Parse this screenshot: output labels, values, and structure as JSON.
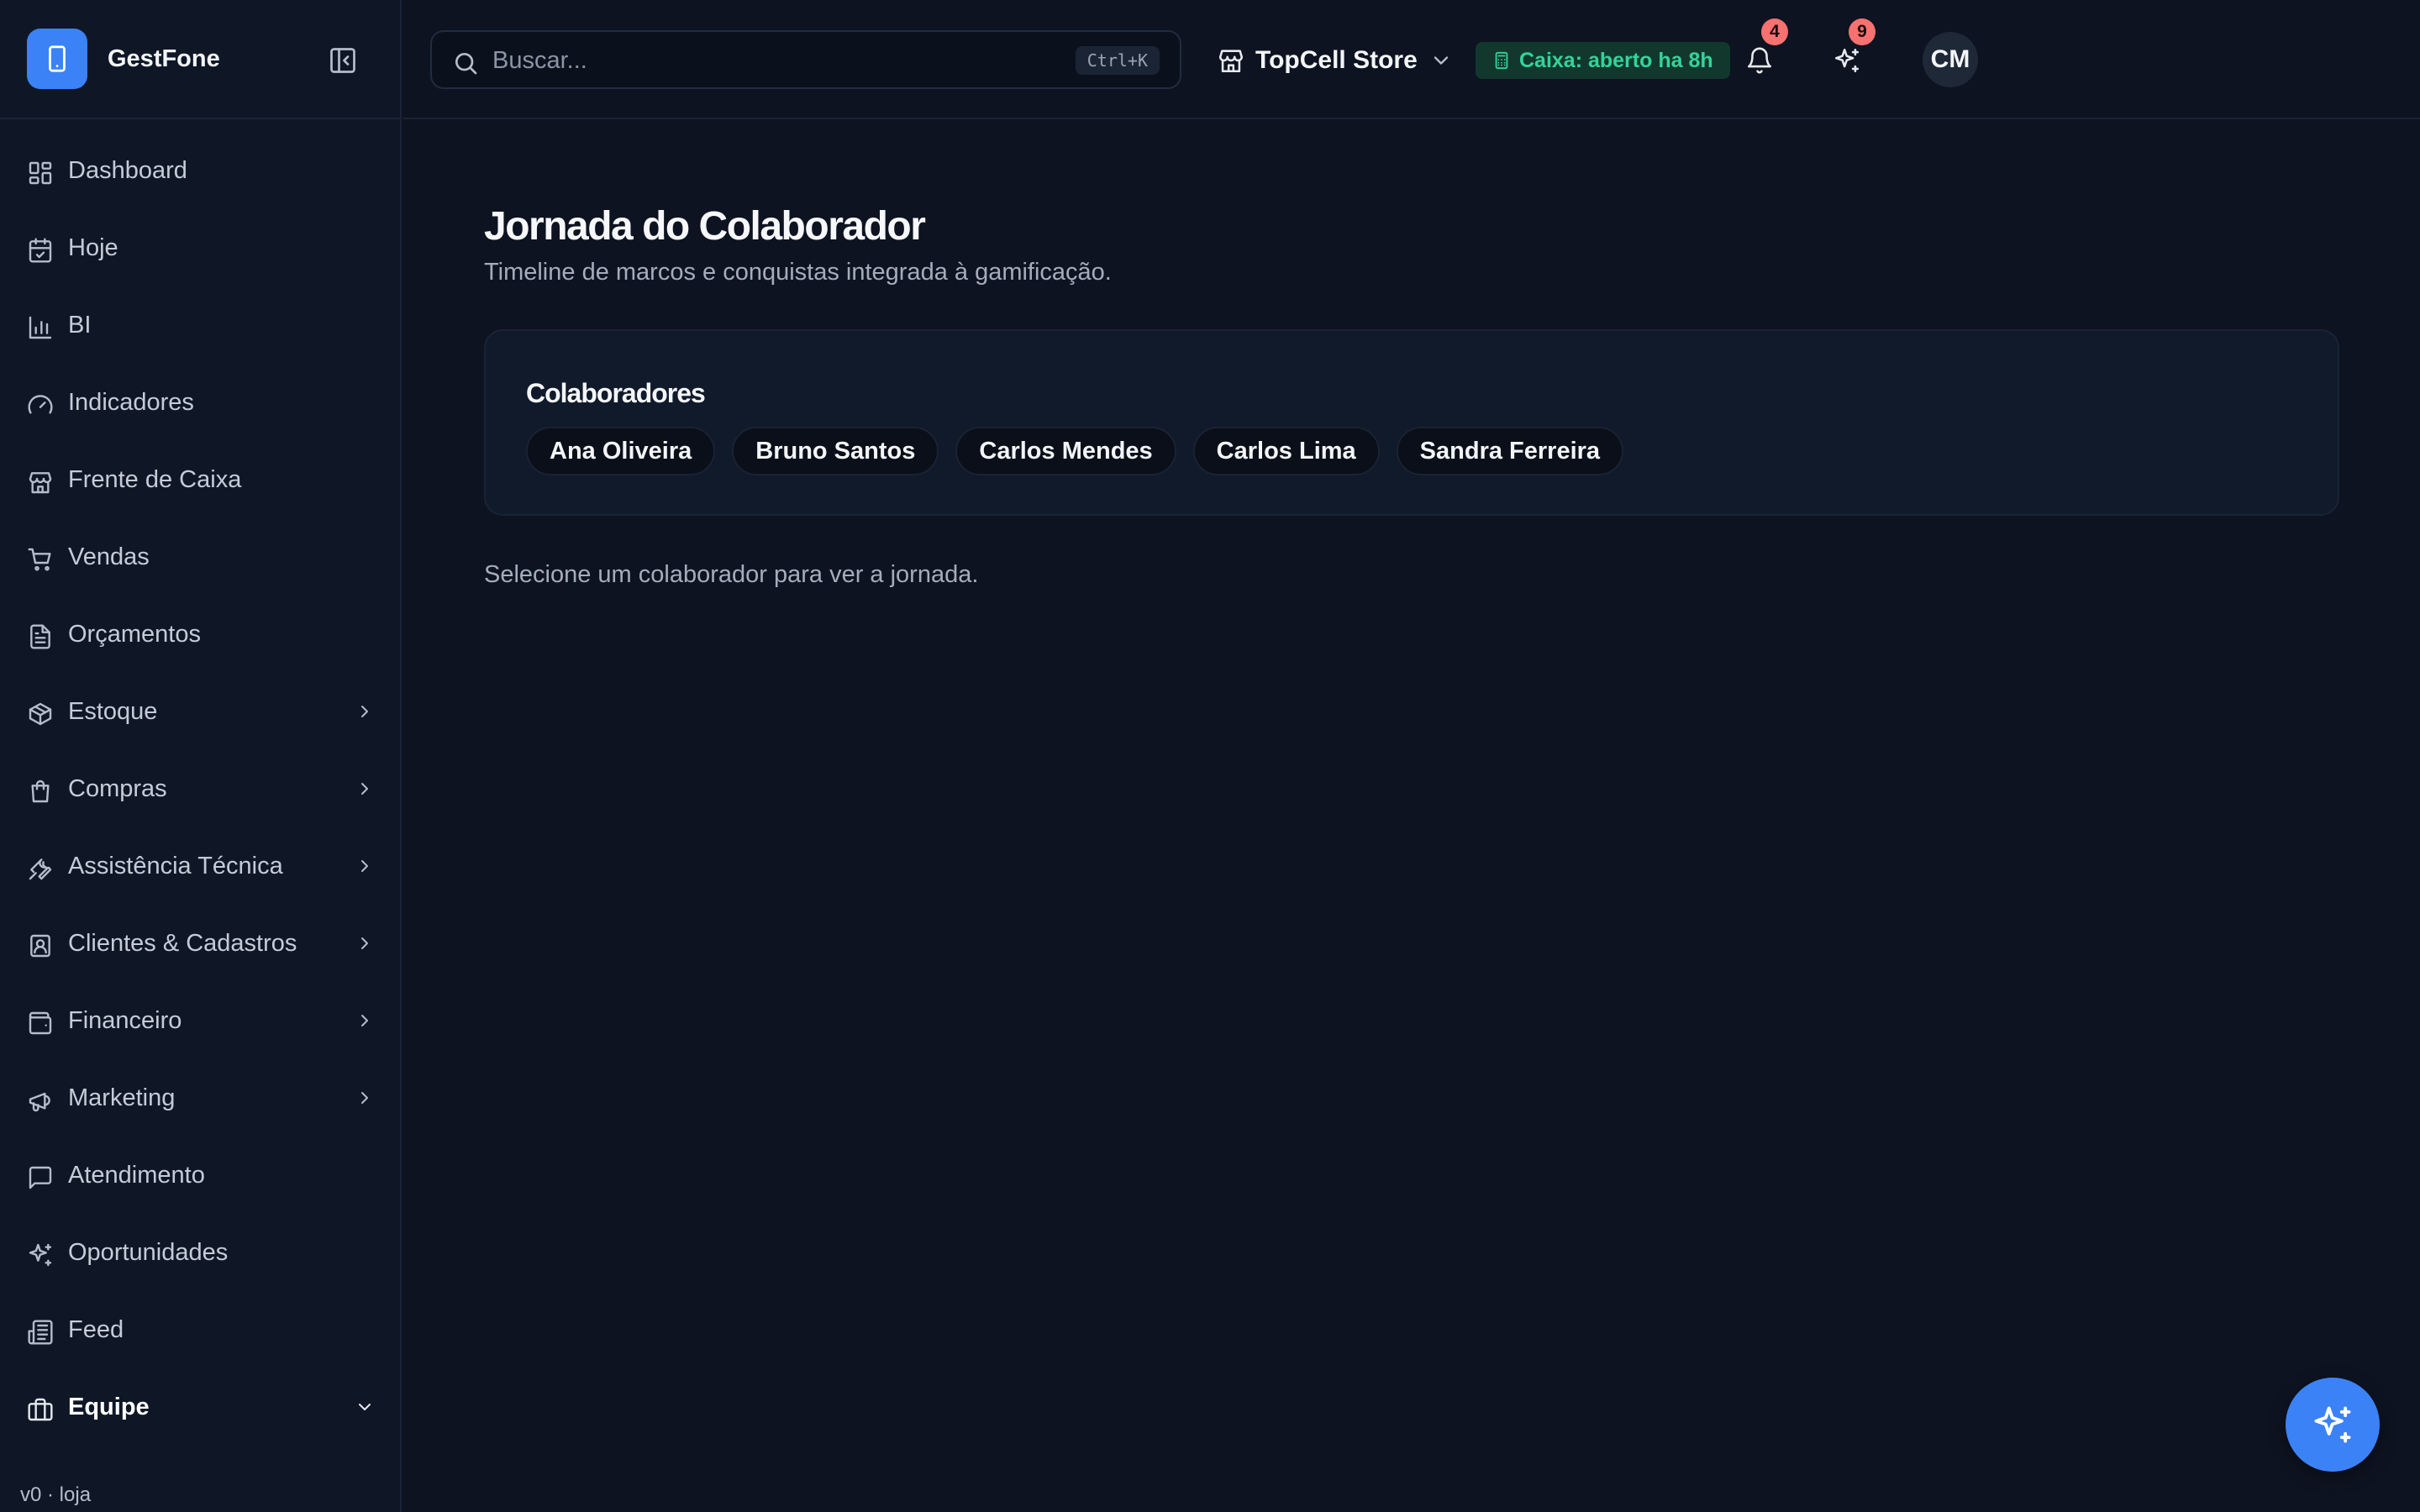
{
  "colors": {
    "accent": "#3b82f6",
    "success": "#34d399",
    "badge": "#f87171",
    "background": "#0d1320"
  },
  "brand": {
    "name": "GestFone",
    "logo_icon": "smartphone-icon"
  },
  "sidebar": {
    "items": [
      {
        "label": "Dashboard",
        "icon": "layout-grid-icon",
        "expandable": false
      },
      {
        "label": "Hoje",
        "icon": "calendar-check-icon",
        "expandable": false
      },
      {
        "label": "BI",
        "icon": "bar-chart-icon",
        "expandable": false
      },
      {
        "label": "Indicadores",
        "icon": "gauge-icon",
        "expandable": false
      },
      {
        "label": "Frente de Caixa",
        "icon": "store-icon",
        "expandable": false
      },
      {
        "label": "Vendas",
        "icon": "cart-icon",
        "expandable": false
      },
      {
        "label": "Orçamentos",
        "icon": "file-text-icon",
        "expandable": false
      },
      {
        "label": "Estoque",
        "icon": "package-icon",
        "expandable": true
      },
      {
        "label": "Compras",
        "icon": "shopping-bag-icon",
        "expandable": true
      },
      {
        "label": "Assistência Técnica",
        "icon": "wrench-icon",
        "expandable": true
      },
      {
        "label": "Clientes & Cadastros",
        "icon": "contact-icon",
        "expandable": true
      },
      {
        "label": "Financeiro",
        "icon": "wallet-icon",
        "expandable": true
      },
      {
        "label": "Marketing",
        "icon": "megaphone-icon",
        "expandable": true
      },
      {
        "label": "Atendimento",
        "icon": "message-square-icon",
        "expandable": false
      },
      {
        "label": "Oportunidades",
        "icon": "sparkles-icon",
        "expandable": false
      },
      {
        "label": "Feed",
        "icon": "newspaper-icon",
        "expandable": false
      },
      {
        "label": "Equipe",
        "icon": "briefcase-icon",
        "expandable": true,
        "active": true
      }
    ],
    "version": "v0 · loja"
  },
  "header": {
    "search_placeholder": "Buscar...",
    "search_shortcut": "Ctrl+K",
    "store_name": "TopCell Store",
    "cash_status": "Caixa: aberto ha 8h",
    "notifications_count": "4",
    "ai_count": "9",
    "user_initials": "CM"
  },
  "main": {
    "title": "Jornada do Colaborador",
    "subtitle": "Timeline de marcos e conquistas integrada à gamificação.",
    "card": {
      "title": "Colaboradores",
      "collaborators": [
        "Ana Oliveira",
        "Bruno Santos",
        "Carlos Mendes",
        "Carlos Lima",
        "Sandra Ferreira"
      ]
    },
    "empty_message": "Selecione um colaborador para ver a jornada."
  }
}
